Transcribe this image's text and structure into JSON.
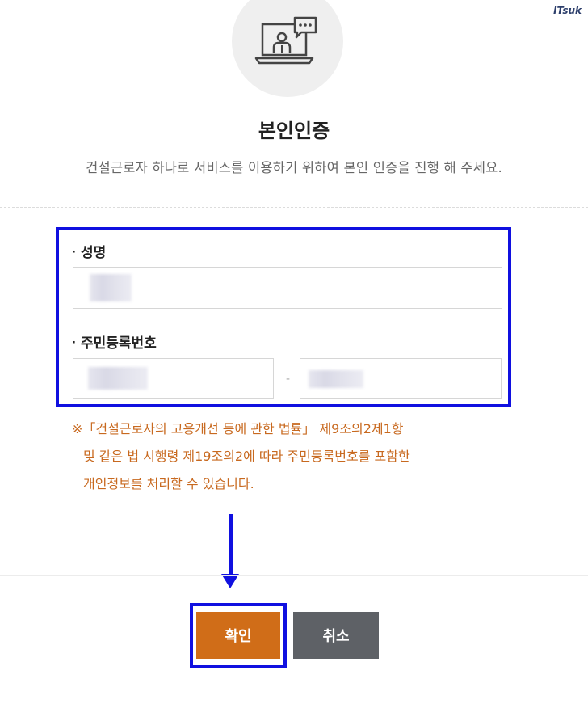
{
  "watermark": "ITsuk",
  "header": {
    "icon": "video-call-person-icon",
    "title": "본인인증",
    "subtitle": "건설근로자 하나로 서비스를 이용하기 위하여 본인 인증을 진행 해 주세요."
  },
  "form": {
    "name_label": "성명",
    "name_value": "",
    "rrn_label": "주민등록번호",
    "rrn_front_value": "",
    "rrn_back_value": "",
    "rrn_separator": "-"
  },
  "notice": {
    "line1": "※「건설근로자의 고용개선 등에 관한 법률」 제9조의2제1항",
    "line2": "및 같은 법 시행령 제19조의2에 따라 주민등록번호를 포함한",
    "line3": "개인정보를 처리할 수 있습니다."
  },
  "buttons": {
    "confirm_label": "확인",
    "cancel_label": "취소"
  },
  "colors": {
    "highlight": "#1010e0",
    "confirm": "#d06d18",
    "cancel": "#5e6166",
    "notice": "#c8691f"
  }
}
